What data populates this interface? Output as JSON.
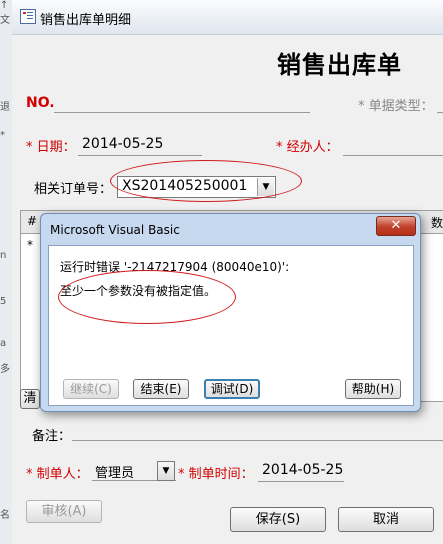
{
  "window": {
    "title": "销售出库单明细"
  },
  "left_edge_fragments": [
    "↑ 文",
    "退",
    "*",
    "n",
    "5",
    "a",
    "多",
    "名"
  ],
  "form": {
    "heading": "销售出库单",
    "no_label": "NO.",
    "doc_type_label": "* 单据类型：",
    "date_label": "* 日期：",
    "date_value": "2014-05-25",
    "handler_label": "* 经办人：",
    "order_label": "相关订单号：",
    "order_value": "XS201405250001",
    "remark_label": "备注：",
    "creator_label": "* 制单人：",
    "creator_value": "管理员",
    "create_time_label": "* 制单时间：",
    "create_time_value": "2014-05-25"
  },
  "grid": {
    "col_hash": "#",
    "col_right": "数",
    "new_row_marker": "*"
  },
  "buttons": {
    "clear_partial": "清",
    "review": "审核(A)",
    "save": "保存(S)",
    "cancel": "取消"
  },
  "dialog": {
    "title": "Microsoft Visual Basic",
    "close_glyph": "✕",
    "error_line": "运行时错误 '-2147217904 (80040e10)':",
    "message": "至少一个参数没有被指定值。",
    "btn_continue": "继续(C)",
    "btn_end": "结束(E)",
    "btn_debug": "调试(D)",
    "btn_help": "帮助(H)"
  },
  "icons": {
    "dropdown": "▼"
  },
  "colors": {
    "required": "#d00000",
    "annotation": "#d11a1a",
    "dialog_frame": "#c6d9ee"
  }
}
